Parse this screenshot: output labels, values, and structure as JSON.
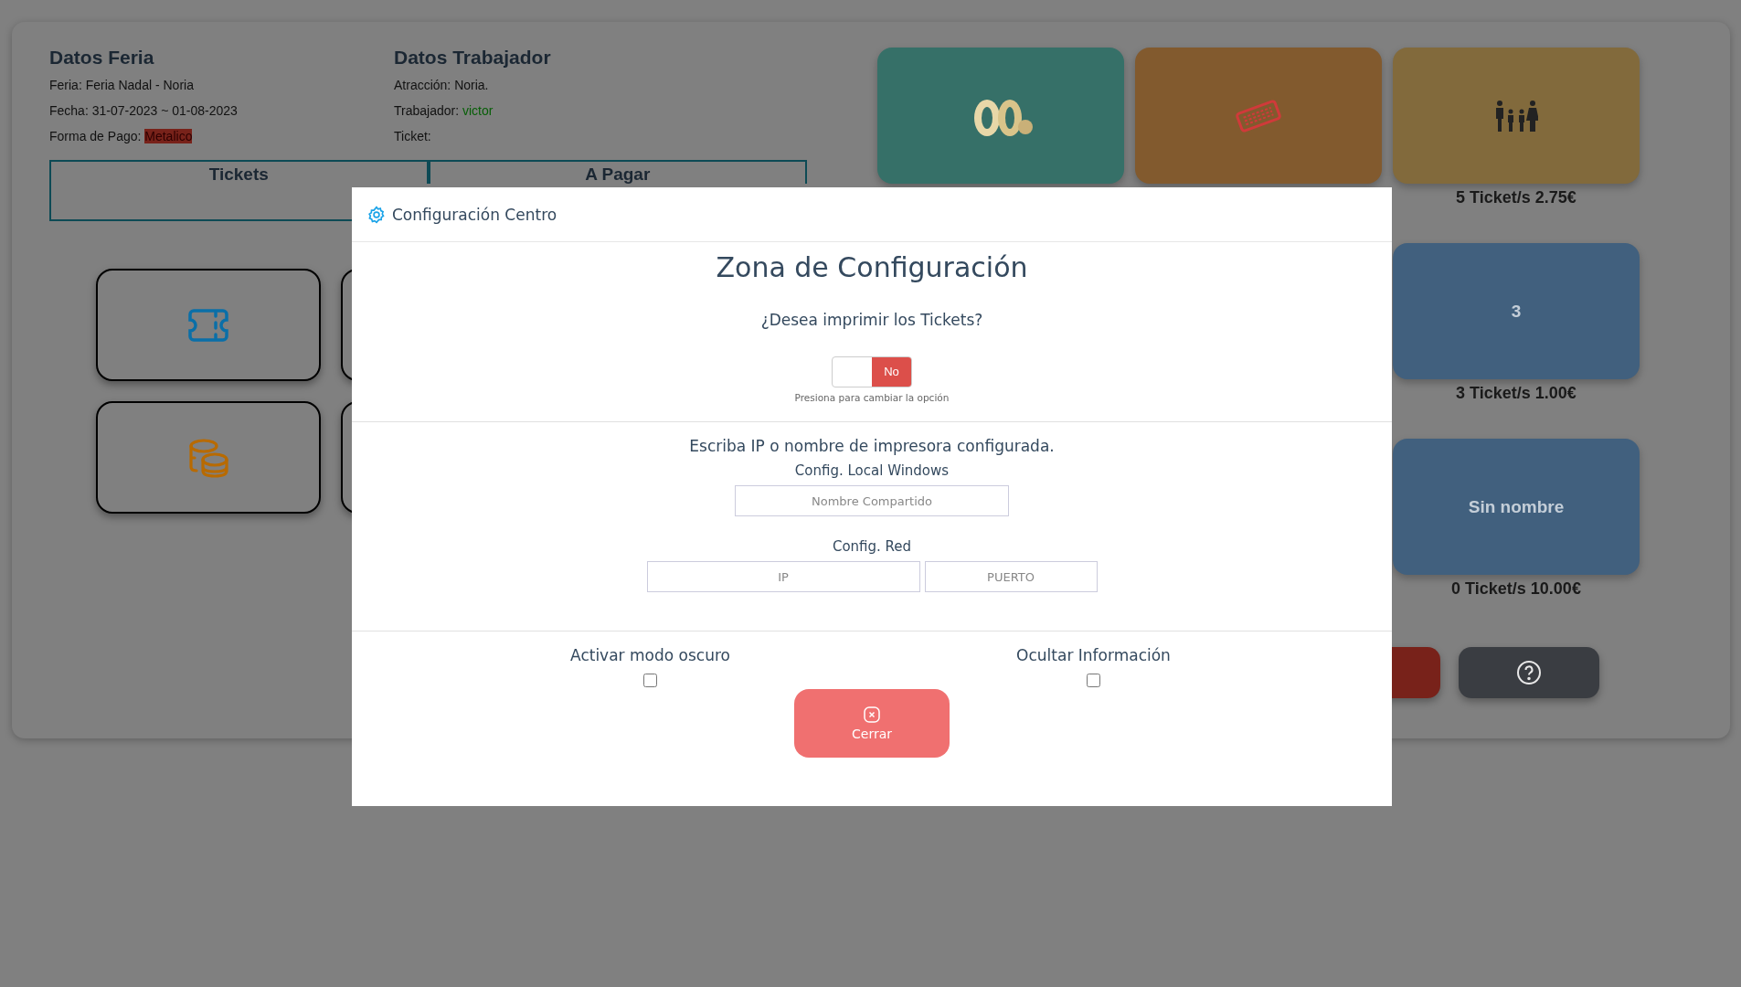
{
  "fair": {
    "title": "Datos Feria",
    "lines": [
      {
        "label": "Feria:",
        "value": "Feria Nadal - Noria",
        "kind": "plain"
      },
      {
        "label": "Fecha:",
        "value": "31-07-2023 ~ 01-08-2023",
        "kind": "plain"
      },
      {
        "label": "Forma de Pago:",
        "value": "Metalico",
        "kind": "danger"
      }
    ]
  },
  "worker": {
    "title": "Datos Trabajador",
    "lines": [
      {
        "label": "Atracción:",
        "value": "Noria.",
        "kind": "plain"
      },
      {
        "label": "Trabajador:",
        "value": "victor",
        "kind": "success"
      },
      {
        "label": "Ticket:"
      }
    ]
  },
  "tabs": [
    {
      "label": "Tickets"
    },
    {
      "label": "A Pagar"
    }
  ],
  "action_buttons": [
    {
      "kind": "ticket"
    },
    {
      "kind": "hidden"
    },
    {
      "kind": "coins"
    },
    {
      "kind": "hidden"
    }
  ],
  "tiles": [
    {
      "kind": "picture",
      "color": "#367068"
    },
    {
      "kind": "stamp",
      "color": "#825a2e"
    },
    {
      "kind": "family",
      "color": "#826a3c",
      "caption": "5 Ticket/s 2.75€"
    },
    {
      "kind": "text",
      "color": "#41607e",
      "label": "3",
      "caption": "3 Ticket/s 1.00€"
    },
    {
      "kind": "text",
      "color": "#41607e",
      "label": "Sin nombre",
      "caption": "0 Ticket/s 10.00€"
    }
  ],
  "footer_buttons": [
    {
      "kind": "danger"
    },
    {
      "kind": "help"
    }
  ],
  "modal": {
    "title": "Configuración Centro",
    "heading": "Zona de Configuración",
    "print_question": "¿Desea imprimir los Tickets?",
    "toggle": {
      "label": "No",
      "on": false
    },
    "toggle_hint": "Presiona para cambiar la opción",
    "printer_prompt": "Escriba IP o nombre de impresora configurada.",
    "local_label": "Config. Local Windows",
    "local_placeholder": "Nombre Compartido",
    "network_label": "Config. Red",
    "ip_placeholder": "IP",
    "port_placeholder": "PUERTO",
    "options": [
      {
        "label": "Activar modo oscuro",
        "checked": false
      },
      {
        "label": "Ocultar Información",
        "checked": false
      }
    ],
    "close_label": "Cerrar"
  }
}
